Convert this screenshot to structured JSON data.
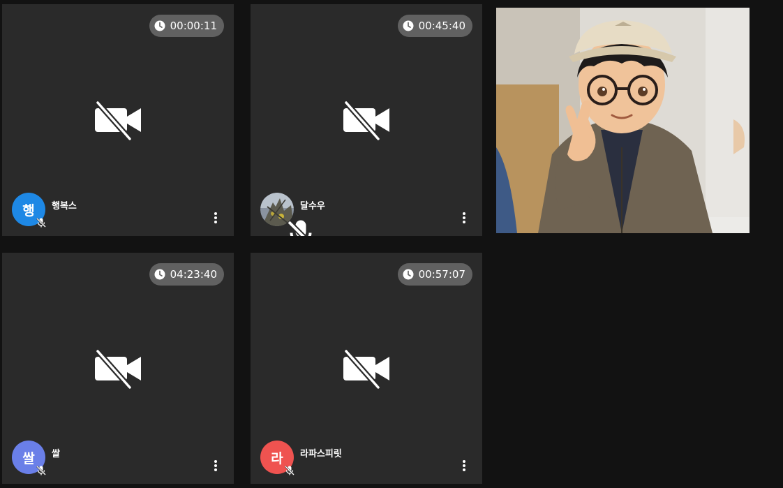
{
  "participants": [
    {
      "name": "행복스",
      "avatar_initial": "행",
      "avatar_color": "#1e88e5",
      "timer": "00:00:11",
      "camera": "off",
      "mic": "muted"
    },
    {
      "name": "달수우",
      "avatar_initial": "",
      "avatar_type": "photo",
      "timer": "00:45:40",
      "camera": "off",
      "mic": "muted"
    },
    {
      "name": "쌀",
      "avatar_initial": "쌀",
      "avatar_color": "#6a7fe8",
      "timer": "04:23:40",
      "camera": "off",
      "mic": "muted"
    },
    {
      "name": "라파스피릿",
      "avatar_initial": "라",
      "avatar_color": "#ef5350",
      "timer": "00:57:07",
      "camera": "off",
      "mic": "muted"
    }
  ],
  "video_tile": {
    "content": "cartoon portrait",
    "camera": "on"
  },
  "colors": {
    "background": "#121212",
    "tile": "#2a2a2a",
    "timer_pill": "#616161"
  },
  "icons": [
    "clock-icon",
    "camera-off-icon",
    "mic-muted-icon",
    "more-vert-icon"
  ]
}
